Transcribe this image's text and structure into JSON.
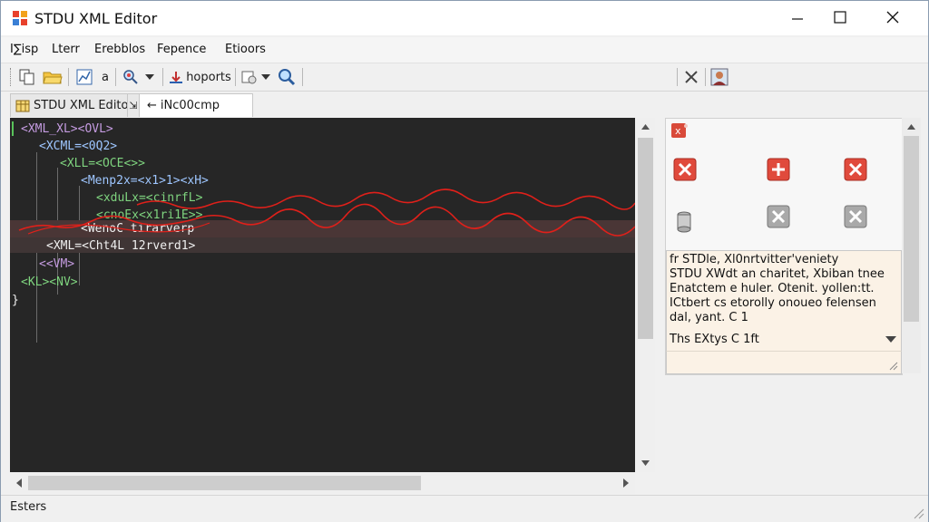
{
  "window": {
    "title": "STDU XML Editor"
  },
  "menu": {
    "items": [
      "I∑isp",
      "Lterr",
      "Erebblos",
      "Fepence",
      "Etioors"
    ]
  },
  "toolbar": {
    "label": "a",
    "button_text": "hoports"
  },
  "tabs": [
    {
      "label": "STDU XML Edito",
      "active": false
    },
    {
      "label": "iNc00cmp",
      "active": true
    }
  ],
  "editor": {
    "lines": [
      {
        "text": "<XML_XL><OVL>"
      },
      {
        "text": "<XCML=<0Q2>"
      },
      {
        "text": "<XLL=<OCE<>>"
      },
      {
        "text": "<Menp2x=<x1>1><xH>"
      },
      {
        "text": "<xduLx=<cinrfL>"
      },
      {
        "text": "<cnoEx<x1ri1E>>"
      },
      {
        "text": "<WenoC tirarverp"
      },
      {
        "text": "<XML=<Cht4L 12rverd1>"
      },
      {
        "text": "<<VM>"
      },
      {
        "text": "<KL><NV>"
      },
      {
        "text": "}"
      }
    ]
  },
  "info_panel": {
    "lines": [
      "fr STDle, Xl0nrtvitter'veniety",
      "STDU XWdt an charitet, Xbiban tnee",
      "Enatctem e huler. Otenit. yollen:tt.",
      "ICtbert cs etorolly onoueo felensen",
      "dal, yant. C 1"
    ],
    "footer": "Ths EXtys C 1ft"
  },
  "status": {
    "text": "Esters"
  },
  "colors": {
    "editor_bg": "#262626",
    "tag": "#9ec6ff",
    "attr": "#7fd47f",
    "keyword": "#c49be0",
    "text": "#f0f0f0",
    "error_squiggle": "#e0201a",
    "highlight_row": "#4a3636"
  },
  "icons": {
    "app": "stdu-app-icon",
    "toolbar": [
      "copy-icon",
      "open-folder-icon",
      "chart-icon",
      "search-icon",
      "dropdown-arrow-icon",
      "imports-icon",
      "filter-icon",
      "dropdown-arrow-icon",
      "zoom-icon",
      "pin-icon",
      "user-icon"
    ],
    "right_panel": [
      "error-badge-icon",
      "delete-icon",
      "add-icon",
      "delete-icon",
      "database-icon",
      "close-gray-icon",
      "close-gray-icon"
    ]
  }
}
